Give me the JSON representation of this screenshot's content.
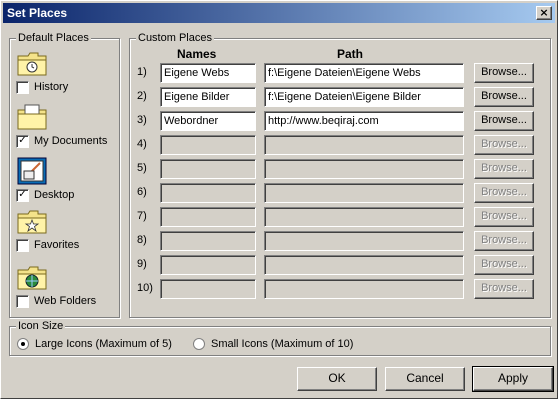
{
  "window": {
    "title": "Set Places",
    "close_glyph": "×"
  },
  "default_places": {
    "label": "Default Places",
    "items": [
      {
        "label": "History",
        "checked": false,
        "icon": "history-folder-icon"
      },
      {
        "label": "My Documents",
        "checked": true,
        "icon": "my-documents-folder-icon"
      },
      {
        "label": "Desktop",
        "checked": true,
        "icon": "desktop-icon"
      },
      {
        "label": "Favorites",
        "checked": false,
        "icon": "favorites-folder-icon"
      },
      {
        "label": "Web Folders",
        "checked": false,
        "icon": "web-folders-icon"
      }
    ]
  },
  "custom_places": {
    "label": "Custom Places",
    "names_header": "Names",
    "path_header": "Path",
    "browse_label": "Browse...",
    "rows": [
      {
        "num": "1)",
        "name": "Eigene Webs",
        "path": "f:\\Eigene Dateien\\Eigene Webs"
      },
      {
        "num": "2)",
        "name": "Eigene Bilder",
        "path": "f:\\Eigene Dateien\\Eigene Bilder"
      },
      {
        "num": "3)",
        "name": "Webordner",
        "path": "http://www.beqiraj.com"
      },
      {
        "num": "4)",
        "name": "",
        "path": ""
      },
      {
        "num": "5)",
        "name": "",
        "path": ""
      },
      {
        "num": "6)",
        "name": "",
        "path": ""
      },
      {
        "num": "7)",
        "name": "",
        "path": ""
      },
      {
        "num": "8)",
        "name": "",
        "path": ""
      },
      {
        "num": "9)",
        "name": "",
        "path": ""
      },
      {
        "num": "10)",
        "name": "",
        "path": ""
      }
    ]
  },
  "icon_size": {
    "label": "Icon Size",
    "large": "Large Icons (Maximum of 5)",
    "small": "Small Icons (Maximum of 10)",
    "selected": "large"
  },
  "buttons": {
    "ok": "OK",
    "cancel": "Cancel",
    "apply": "Apply"
  }
}
